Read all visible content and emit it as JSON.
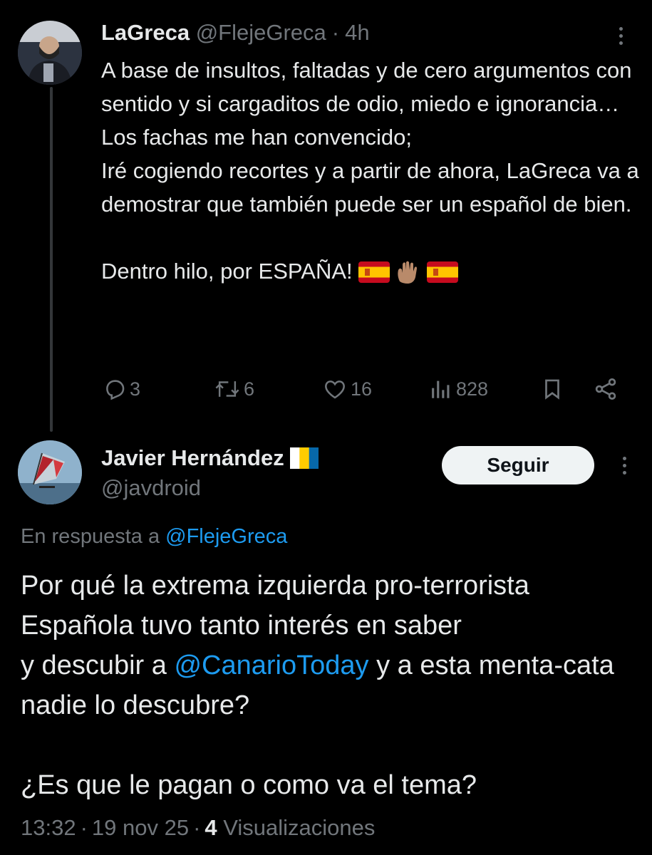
{
  "colors": {
    "background": "#000000",
    "text": "#e7e9ea",
    "muted": "#71767b",
    "link": "#1d9bf0",
    "thread_line": "#333639"
  },
  "tweet1": {
    "author_name": "LaGreca",
    "author_handle": "@FlejeGreca",
    "time": "4h",
    "text_main": "A base de insultos, faltadas y de cero argumentos con sentido y si cargaditos de odio, miedo e ignorancia… Los fachas me han convencido;\nIré cogiendo recortes y a partir de ahora, LaGreca va a demostrar que también puede ser un español de bien.\n\nDentro hilo, por ESPAÑA! ",
    "emoji": [
      "spain-flag",
      "raised-hand",
      "spain-flag"
    ],
    "stats": {
      "replies": "3",
      "retweets": "6",
      "likes": "16",
      "views": "828"
    }
  },
  "tweet2": {
    "author_name": "Javier Hernández",
    "author_flag": "canary-islands-flag",
    "author_handle": "@javdroid",
    "follow_label": "Seguir",
    "reply_prefix": "En respuesta a ",
    "reply_to": "@FlejeGreca",
    "text_part1": "Por qué la extrema izquierda pro-terrorista Española tuvo tanto interés en saber\ny descubir a ",
    "mention": "@CanarioToday",
    "text_part2": " y a esta menta-cata nadie lo descubre?\n\n¿Es que le pagan o como va el tema?",
    "time": "13:32",
    "date": "19 nov 25",
    "views_count": "4",
    "views_label": "Visualizaciones"
  }
}
